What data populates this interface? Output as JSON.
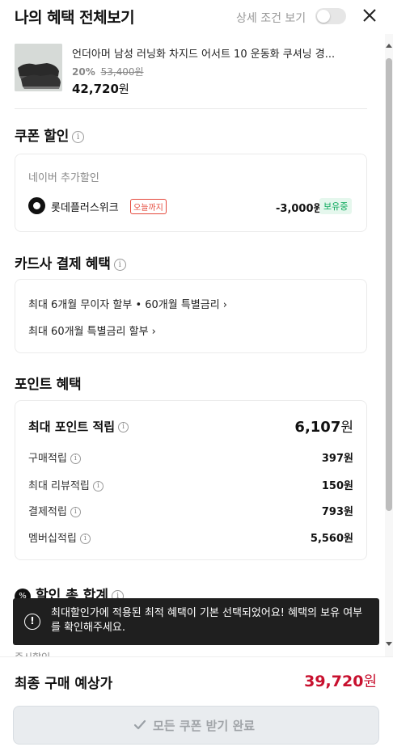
{
  "header": {
    "title": "나의 혜택 전체보기",
    "toggle_label": "상세 조건 보기"
  },
  "product": {
    "name": "언더아머 남성 러닝화 차지드 어서트 10 운동화 쿠셔닝 경...",
    "discount_rate": "20%",
    "original_price": "53,400원",
    "sale_price": "42,720",
    "sale_unit": "원"
  },
  "coupon": {
    "title": "쿠폰 할인",
    "subtitle": "네이버 추가할인",
    "name": "롯데플러스위크",
    "until": "오늘까지",
    "amount": "-3,000원",
    "status": "보유중"
  },
  "card": {
    "title": "카드사 결제 혜택",
    "links": [
      "최대 6개월 무이자 할부 • 60개월 특별금리 ›",
      "최대 60개월 특별금리 할부 ›"
    ]
  },
  "points": {
    "title": "포인트 혜택",
    "max_label": "최대 포인트 적립",
    "max_value": "6,107",
    "max_unit": "원",
    "rows": [
      {
        "label": "구매적립",
        "value": "397원"
      },
      {
        "label": "최대 리뷰적립",
        "value": "150원"
      },
      {
        "label": "결제적립",
        "value": "793원"
      },
      {
        "label": "멤버십적립",
        "value": "5,560원"
      }
    ]
  },
  "total": {
    "title": "할인 총 합계",
    "icon_text": "%",
    "partial_row": "즉시할인"
  },
  "toast": {
    "message": "최대할인가에 적용된 최적 혜택이 기본 선택되었어요! 혜택의 보유 여부를 확인해주세요."
  },
  "footer": {
    "label": "최종 구매 예상가",
    "price": "39,720",
    "unit": "원",
    "button": "모든 쿠폰 받기 완료"
  },
  "colors": {
    "accent_red": "#c8102e",
    "owned_green": "#0aa85a",
    "until_red": "#e5483b"
  }
}
